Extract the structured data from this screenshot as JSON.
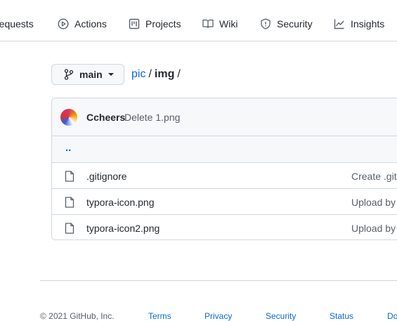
{
  "repo_nav": {
    "items": [
      {
        "label": "requests",
        "icon": "pull-request-icon"
      },
      {
        "label": "Actions",
        "icon": "play-icon"
      },
      {
        "label": "Projects",
        "icon": "project-icon"
      },
      {
        "label": "Wiki",
        "icon": "book-icon"
      },
      {
        "label": "Security",
        "icon": "shield-icon"
      },
      {
        "label": "Insights",
        "icon": "graph-icon"
      }
    ]
  },
  "branch": {
    "name": "main"
  },
  "breadcrumb": {
    "repo": "pic",
    "separator": "/",
    "current": "img",
    "trailing": "/"
  },
  "commit": {
    "author": "Ccheers",
    "message": "Delete 1.png"
  },
  "parent_link": "..",
  "files": [
    {
      "name": ".gitignore",
      "last_commit": "Create .giti"
    },
    {
      "name": "typora-icon.png",
      "last_commit": "Upload by"
    },
    {
      "name": "typora-icon2.png",
      "last_commit": "Upload by"
    }
  ],
  "footer": {
    "copyright": "© 2021 GitHub, Inc.",
    "links": [
      "Terms",
      "Privacy",
      "Security",
      "Status",
      "Do"
    ]
  },
  "colors": {
    "link": "#0969da",
    "border": "#d0d7de",
    "muted": "#57606a",
    "text": "#24292f"
  }
}
